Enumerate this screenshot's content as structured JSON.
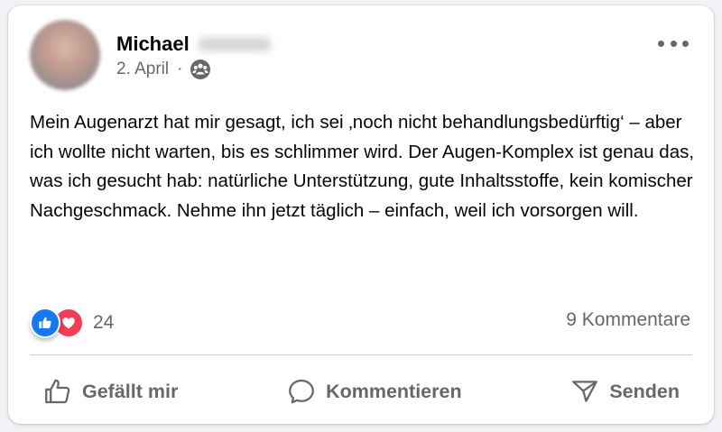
{
  "post": {
    "author_first_name": "Michael",
    "date": "2. April",
    "separator": "·",
    "audience_icon": "friends-icon",
    "text": "Mein Augenarzt hat mir gesagt, ich sei ‚noch nicht behandlungsbedürftig‘ – aber ich wollte nicht warten, bis es schlimmer wird. Der Augen-Komplex ist genau das, was ich gesucht hab: natürliche Unterstützung, gute Inhaltsstoffe, kein komischer Nachgeschmack. Nehme ihn jetzt täglich – einfach, weil ich vorsorgen will.",
    "reaction_count": "24",
    "reaction_icons": [
      "like-icon",
      "love-icon"
    ],
    "comments_label": "9 Kommentare"
  },
  "actions": {
    "like_label": "Gefällt mir",
    "comment_label": "Kommentieren",
    "share_label": "Senden"
  },
  "colors": {
    "like_blue": "#1877f2",
    "love_red": "#f33e58",
    "secondary_text": "#65676b"
  }
}
